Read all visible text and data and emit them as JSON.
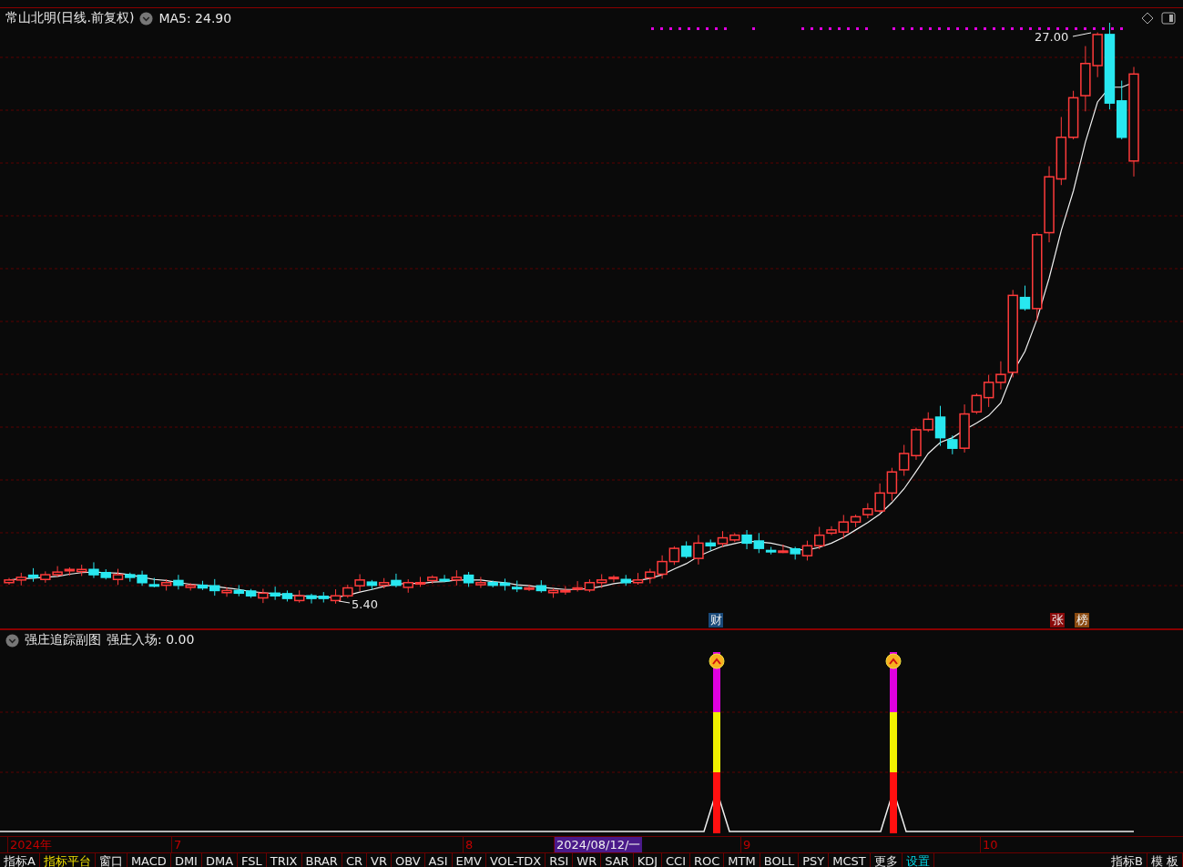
{
  "title": "常山北明(日线.前复权)",
  "ma_label": "MA5: 24.90",
  "high_label": "27.00",
  "low_label": "5.40",
  "markers": [
    {
      "text": "财",
      "color": "#1a4a7a"
    },
    {
      "text": "张",
      "color": "#8a0a0a"
    },
    {
      "text": "榜",
      "color": "#8a4a10"
    }
  ],
  "indicator": {
    "name": "强庄追踪副图",
    "value": "强庄入场: 0.00"
  },
  "time_axis": [
    {
      "label": "2024年",
      "selected": false
    },
    {
      "label": "7",
      "selected": false
    },
    {
      "label": "8",
      "selected": false
    },
    {
      "label": "2024/08/12/一",
      "selected": true
    },
    {
      "label": "9",
      "selected": false
    },
    {
      "label": "10",
      "selected": false
    }
  ],
  "tabs": [
    {
      "label": "指标A",
      "color": "#e8e8e8"
    },
    {
      "label": "指标平台",
      "color": "#f0e000"
    },
    {
      "label": "窗口",
      "color": "#e8e8e8"
    },
    {
      "label": "MACD",
      "color": "#e8e8e8"
    },
    {
      "label": "DMI",
      "color": "#e8e8e8"
    },
    {
      "label": "DMA",
      "color": "#e8e8e8"
    },
    {
      "label": "FSL",
      "color": "#e8e8e8"
    },
    {
      "label": "TRIX",
      "color": "#e8e8e8"
    },
    {
      "label": "BRAR",
      "color": "#e8e8e8"
    },
    {
      "label": "CR",
      "color": "#e8e8e8"
    },
    {
      "label": "VR",
      "color": "#e8e8e8"
    },
    {
      "label": "OBV",
      "color": "#e8e8e8"
    },
    {
      "label": "ASI",
      "color": "#e8e8e8"
    },
    {
      "label": "EMV",
      "color": "#e8e8e8"
    },
    {
      "label": "VOL-TDX",
      "color": "#e8e8e8"
    },
    {
      "label": "RSI",
      "color": "#e8e8e8"
    },
    {
      "label": "WR",
      "color": "#e8e8e8"
    },
    {
      "label": "SAR",
      "color": "#e8e8e8"
    },
    {
      "label": "KDJ",
      "color": "#e8e8e8"
    },
    {
      "label": "CCI",
      "color": "#e8e8e8"
    },
    {
      "label": "ROC",
      "color": "#e8e8e8"
    },
    {
      "label": "MTM",
      "color": "#e8e8e8"
    },
    {
      "label": "BOLL",
      "color": "#e8e8e8"
    },
    {
      "label": "PSY",
      "color": "#e8e8e8"
    },
    {
      "label": "MCST",
      "color": "#e8e8e8"
    },
    {
      "label": "更多",
      "color": "#e8e8e8"
    },
    {
      "label": "设置",
      "color": "#00d8e8"
    }
  ],
  "right_tabs": [
    {
      "label": "指标B",
      "color": "#e8e8e8"
    },
    {
      "label": "模 板",
      "color": "#e8e8e8"
    }
  ]
}
